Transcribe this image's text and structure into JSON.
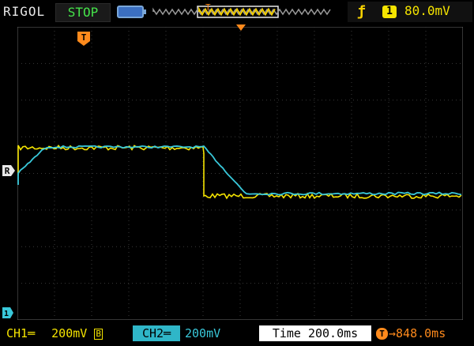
{
  "header": {
    "brand": "RIGOL",
    "run_state": "STOP",
    "trigger_level": "80.0mV",
    "trigger_source": "1",
    "trigger_edge_icon": "rising-edge-icon"
  },
  "channels": {
    "ch1": {
      "name": "CH1",
      "scale": "200mV",
      "coupling_badge": "B",
      "color": "#f5e400"
    },
    "ch2": {
      "name": "CH2",
      "scale": "200mV",
      "color": "#39c8da"
    }
  },
  "timebase": {
    "label": "Time",
    "value": "200.0ms"
  },
  "trigger_offset": {
    "icon": "T",
    "value": "848.0ms"
  },
  "markers": {
    "trigger_marker": "T",
    "ref_marker": "R",
    "ch1_marker": "1"
  },
  "colors": {
    "ch1": "#f5e400",
    "ch2": "#39c8da",
    "trigger": "#ff8a1c",
    "grid": "#3a3a3a",
    "status_green": "#45e34a"
  }
}
